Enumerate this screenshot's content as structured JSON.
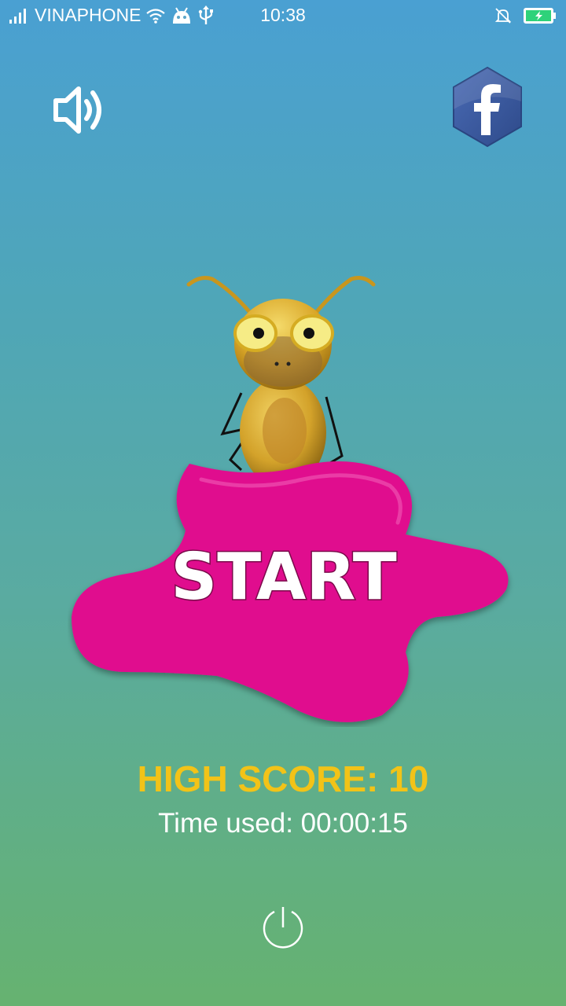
{
  "status_bar": {
    "carrier": "VINAPHONE",
    "time": "10:38"
  },
  "game": {
    "start_label": "START",
    "high_score": "HIGH SCORE: 10",
    "time_used": "Time used: 00:00:15"
  },
  "icons": {
    "sound": "speaker-icon",
    "share": "facebook-icon",
    "quit": "power-icon"
  },
  "colors": {
    "start_splash": "#e0108e",
    "high_score_text": "#f2c318",
    "facebook_blue": "#3b5a9d"
  }
}
